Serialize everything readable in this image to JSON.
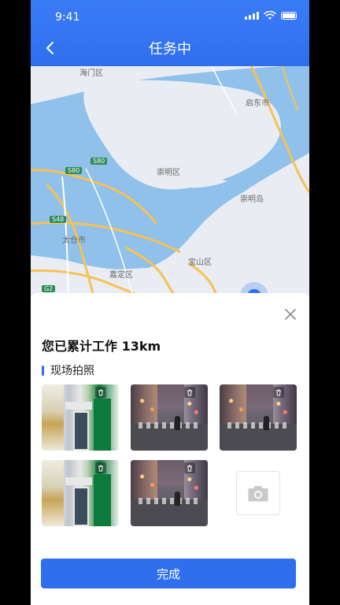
{
  "status_bar": {
    "time": "9:41"
  },
  "header": {
    "title": "任务中"
  },
  "map": {
    "labels": {
      "haimen": "海门区",
      "qidong": "启东市",
      "chongming_qu": "崇明区",
      "chongming_dao": "崇明岛",
      "taicang": "太仓市",
      "jiading": "嘉定区",
      "baoshan": "宝山区"
    },
    "road_badges": {
      "s80a": "S80",
      "s80b": "S80",
      "s48": "S48",
      "g2": "G2"
    }
  },
  "sheet": {
    "summary": "您已累计工作 13km",
    "section_title": "现场拍照",
    "photos": [
      "store",
      "street",
      "street",
      "store",
      "street"
    ],
    "done_label": "完成"
  },
  "colors": {
    "primary": "#2f6fee",
    "water": "#8fc1ea",
    "land": "#e9edf3",
    "road": "#f6c156"
  },
  "icons": {
    "back": "chevron-left-icon",
    "close": "close-icon",
    "trash": "trash-icon",
    "camera": "camera-icon"
  }
}
